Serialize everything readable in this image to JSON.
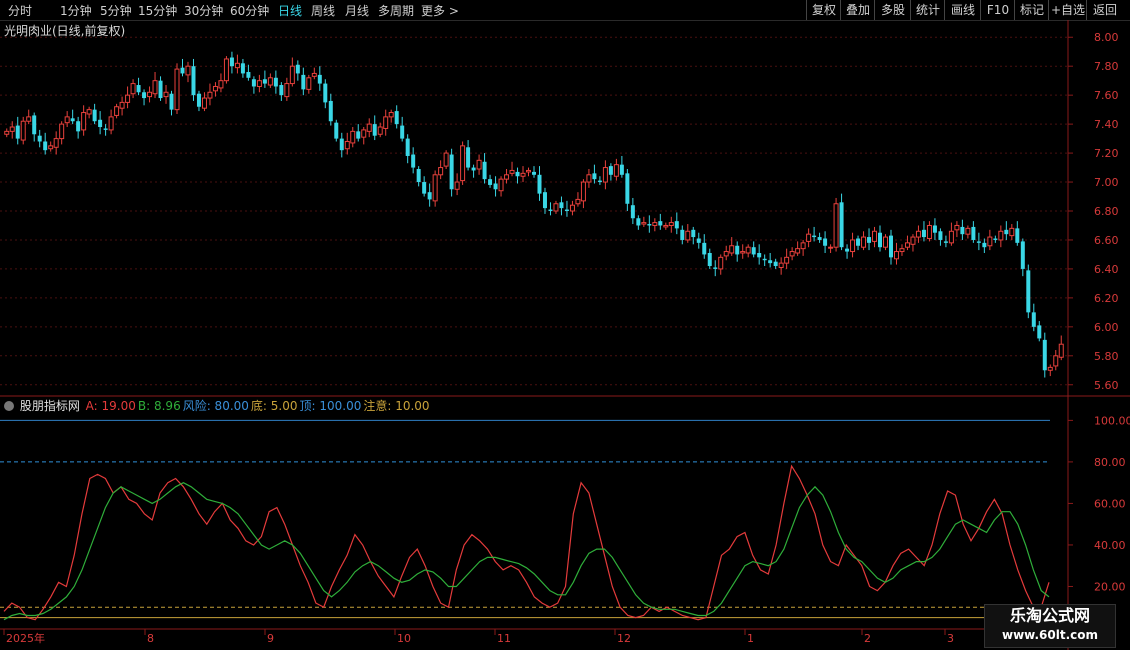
{
  "toolbar": {
    "left_tabs": [
      "分时",
      "1分钟",
      "5分钟",
      "15分钟",
      "30分钟",
      "60分钟",
      "日线",
      "周线",
      "月线",
      "多周期",
      "更多 >"
    ],
    "active_tab": "日线",
    "right_tabs": [
      "复权",
      "叠加",
      "多股",
      "统计",
      "画线",
      "F10",
      "标记",
      "+自选",
      "返回"
    ]
  },
  "stock": {
    "title": "光明肉业(日线,前复权)"
  },
  "price_axis": [
    "8.00",
    "7.80",
    "7.60",
    "7.40",
    "7.20",
    "7.00",
    "6.80",
    "6.60",
    "6.40",
    "6.20",
    "6.00",
    "5.80",
    "5.60"
  ],
  "indicator": {
    "name": "股朋指标网",
    "params": [
      {
        "label": "A: 19.00",
        "color": "#e43b3b"
      },
      {
        "label": "B: 8.96",
        "color": "#2fae3a"
      },
      {
        "label": "风险: 80.00",
        "color": "#3a8fd8"
      },
      {
        "label": "底: 5.00",
        "color": "#c8a23a"
      },
      {
        "label": "顶: 100.00",
        "color": "#3a8fd8"
      },
      {
        "label": "注意: 10.00",
        "color": "#c8a23a"
      }
    ],
    "axis": [
      "100.00",
      "80.00",
      "60.00",
      "40.00",
      "20.00"
    ]
  },
  "date_axis": [
    "2025年",
    "8",
    "9",
    "10",
    "11",
    "12",
    "1",
    "2",
    "3"
  ],
  "watermark": {
    "title": "乐淘公式网",
    "url": "www.60lt.com"
  },
  "colors": {
    "up": "#e8413c",
    "down": "#3ad7e6",
    "grid": "#4a1010",
    "axis": "#8a1a1a"
  },
  "chart_data": [
    {
      "type": "candlestick",
      "title": "光明肉业(日线,前复权)",
      "ylim": [
        5.55,
        8.05
      ],
      "close": [
        7.35,
        7.38,
        7.3,
        7.42,
        7.45,
        7.33,
        7.28,
        7.22,
        7.25,
        7.3,
        7.4,
        7.45,
        7.42,
        7.35,
        7.48,
        7.5,
        7.42,
        7.38,
        7.36,
        7.45,
        7.52,
        7.55,
        7.6,
        7.68,
        7.62,
        7.58,
        7.62,
        7.7,
        7.58,
        7.62,
        7.5,
        7.78,
        7.75,
        7.8,
        7.6,
        7.52,
        7.58,
        7.62,
        7.66,
        7.7,
        7.85,
        7.8,
        7.82,
        7.75,
        7.72,
        7.66,
        7.7,
        7.68,
        7.72,
        7.66,
        7.6,
        7.68,
        7.8,
        7.75,
        7.64,
        7.72,
        7.75,
        7.68,
        7.55,
        7.42,
        7.3,
        7.22,
        7.28,
        7.35,
        7.3,
        7.36,
        7.4,
        7.32,
        7.38,
        7.45,
        7.48,
        7.4,
        7.3,
        7.18,
        7.1,
        7.0,
        6.92,
        6.88,
        7.05,
        7.1,
        7.2,
        6.95,
        7.0,
        7.25,
        7.1,
        7.08,
        7.15,
        7.02,
        6.98,
        6.95,
        7.02,
        7.05,
        7.08,
        7.04,
        7.06,
        7.08,
        7.05,
        6.92,
        6.82,
        6.8,
        6.85,
        6.82,
        6.8,
        6.84,
        6.88,
        7.0,
        7.05,
        7.02,
        7.0,
        7.1,
        7.05,
        7.12,
        7.05,
        6.85,
        6.75,
        6.7,
        6.72,
        6.7,
        6.72,
        6.7,
        6.7,
        6.72,
        6.68,
        6.6,
        6.66,
        6.62,
        6.58,
        6.5,
        6.42,
        6.4,
        6.48,
        6.52,
        6.56,
        6.5,
        6.52,
        6.55,
        6.5,
        6.48,
        6.46,
        6.44,
        6.42,
        6.44,
        6.48,
        6.52,
        6.54,
        6.58,
        6.64,
        6.62,
        6.6,
        6.56,
        6.55,
        6.85,
        6.55,
        6.52,
        6.6,
        6.56,
        6.62,
        6.58,
        6.66,
        6.55,
        6.62,
        6.48,
        6.52,
        6.54,
        6.58,
        6.62,
        6.66,
        6.62,
        6.7,
        6.65,
        6.6,
        6.58,
        6.66,
        6.7,
        6.64,
        6.68,
        6.6,
        6.58,
        6.55,
        6.62,
        6.6,
        6.66,
        6.64,
        6.68,
        6.58,
        6.4,
        6.1,
        6.0,
        5.92,
        5.7,
        5.72,
        5.8,
        5.88
      ],
      "annotation": "日线 K线"
    },
    {
      "type": "line",
      "title": "股朋指标网",
      "ylim": [
        0,
        105
      ],
      "series": [
        {
          "name": "A",
          "values": [
            8,
            12,
            10,
            5,
            4,
            9,
            15,
            22,
            20,
            35,
            55,
            72,
            74,
            72,
            65,
            68,
            62,
            60,
            55,
            52,
            65,
            70,
            72,
            68,
            62,
            55,
            50,
            56,
            60,
            52,
            48,
            42,
            40,
            44,
            56,
            58,
            50,
            40,
            30,
            22,
            12,
            10,
            20,
            28,
            35,
            45,
            40,
            32,
            25,
            20,
            15,
            25,
            34,
            38,
            30,
            20,
            12,
            10,
            28,
            40,
            45,
            42,
            38,
            32,
            28,
            30,
            28,
            22,
            15,
            12,
            10,
            12,
            20,
            55,
            70,
            65,
            50,
            35,
            20,
            10,
            6,
            5,
            6,
            10,
            8,
            10,
            8,
            6,
            5,
            4,
            5,
            20,
            35,
            38,
            44,
            46,
            35,
            28,
            26,
            40,
            60,
            78,
            72,
            64,
            55,
            40,
            32,
            30,
            40,
            35,
            30,
            20,
            18,
            22,
            30,
            36,
            38,
            34,
            30,
            40,
            55,
            66,
            64,
            50,
            42,
            48,
            56,
            62,
            55,
            40,
            28,
            18,
            10,
            10,
            22
          ],
          "color": "#e43b3b"
        },
        {
          "name": "B",
          "values": [
            4,
            6,
            7,
            6,
            6,
            7,
            9,
            12,
            15,
            20,
            28,
            38,
            48,
            58,
            65,
            68,
            66,
            64,
            62,
            60,
            62,
            65,
            68,
            70,
            68,
            65,
            62,
            61,
            60,
            58,
            55,
            50,
            45,
            40,
            38,
            40,
            42,
            40,
            36,
            30,
            24,
            18,
            15,
            18,
            22,
            27,
            30,
            32,
            30,
            27,
            24,
            22,
            23,
            26,
            28,
            27,
            24,
            20,
            20,
            24,
            28,
            32,
            34,
            34,
            33,
            32,
            31,
            29,
            26,
            22,
            18,
            16,
            16,
            22,
            30,
            36,
            38,
            38,
            34,
            28,
            22,
            16,
            12,
            10,
            9,
            9,
            9,
            8,
            7,
            6,
            6,
            8,
            12,
            18,
            24,
            30,
            32,
            31,
            30,
            32,
            38,
            48,
            58,
            64,
            68,
            64,
            56,
            46,
            38,
            34,
            32,
            28,
            24,
            22,
            24,
            28,
            30,
            32,
            32,
            34,
            38,
            44,
            50,
            52,
            50,
            48,
            46,
            52,
            56,
            56,
            50,
            40,
            28,
            18,
            15
          ],
          "color": "#2fae3a"
        }
      ],
      "guides": {
        "风险": 80,
        "底": 5,
        "顶": 100,
        "注意": 10
      }
    }
  ]
}
